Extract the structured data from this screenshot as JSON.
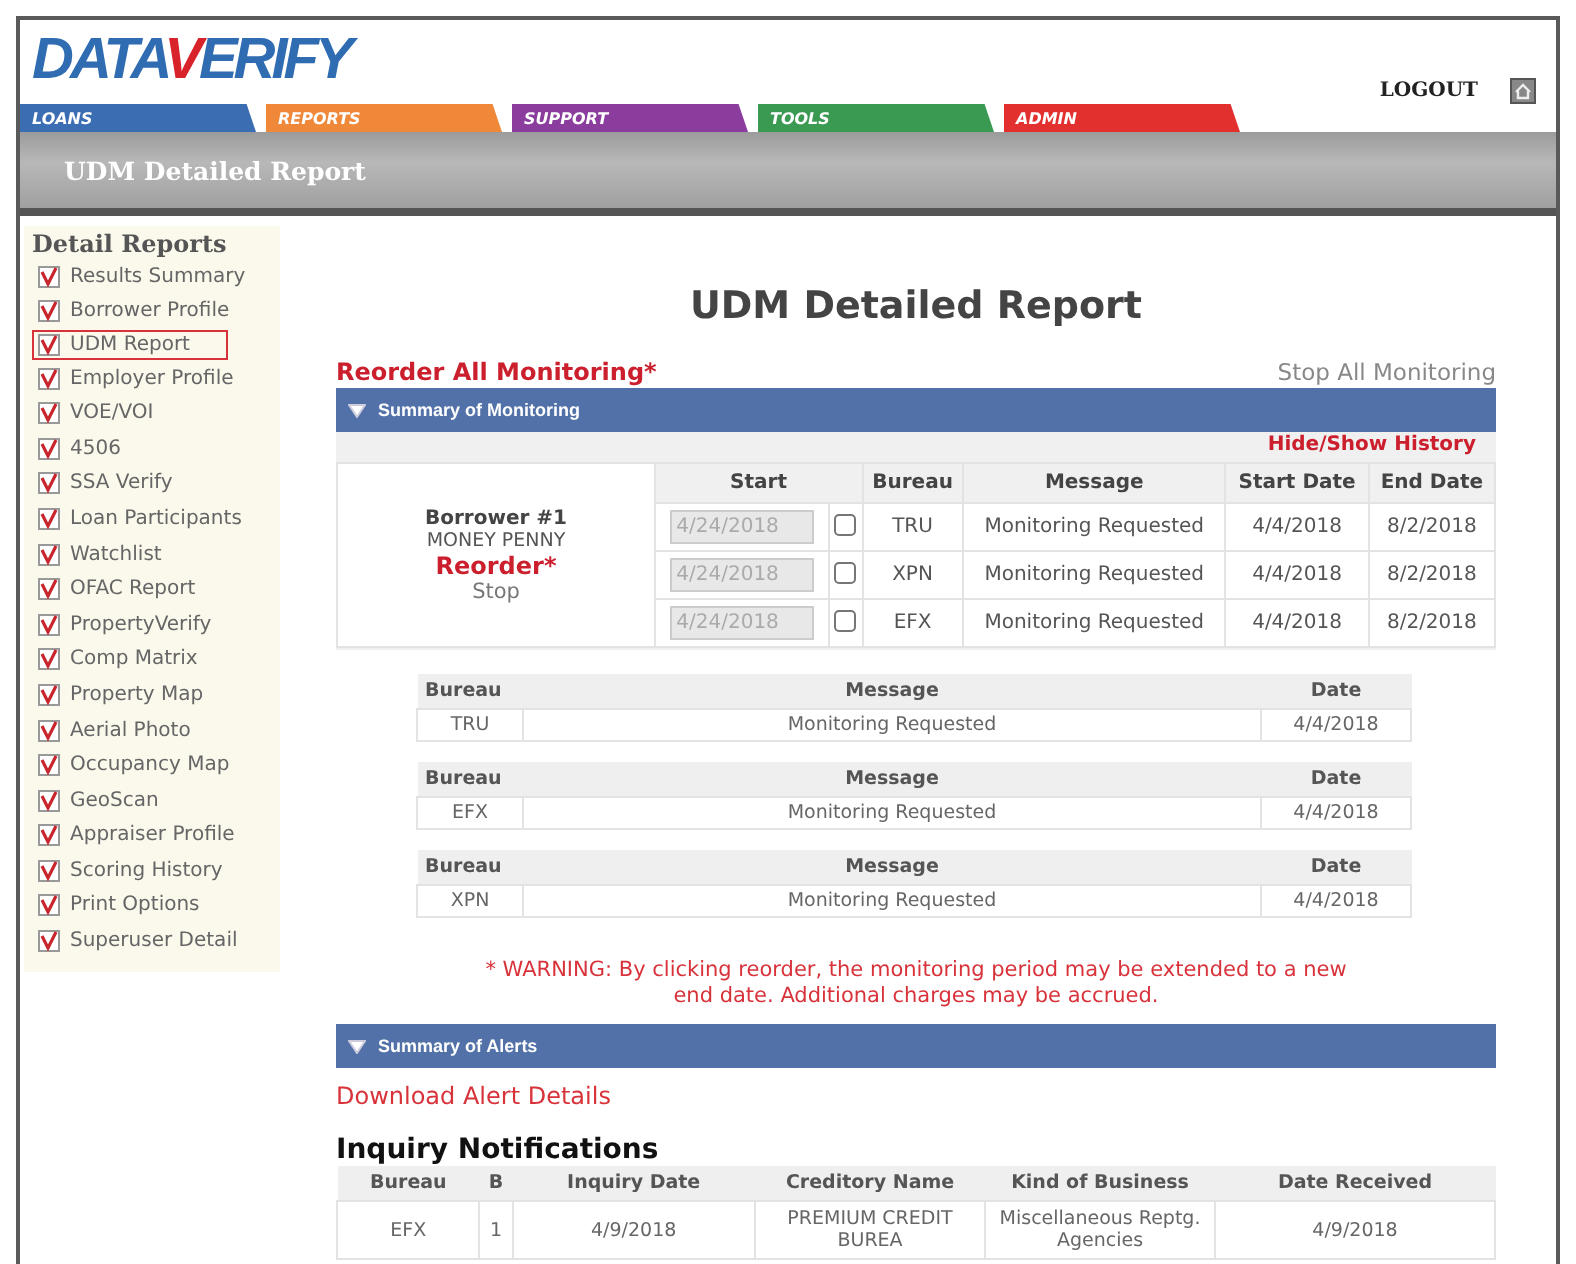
{
  "logo": {
    "part_1": "DATA",
    "part_2": "VERIFY"
  },
  "logout": "LOGOUT",
  "nav_tabs": [
    {
      "label": "LOANS",
      "color": "#3b6db3"
    },
    {
      "label": "REPORTS",
      "color": "#f0883a"
    },
    {
      "label": "SUPPORT",
      "color": "#8b3d9e"
    },
    {
      "label": "TOOLS",
      "color": "#3a9a52"
    },
    {
      "label": "ADMIN",
      "color": "#e2302f"
    }
  ],
  "title_bar": "UDM Detailed Report",
  "sidebar": {
    "heading": "Detail Reports",
    "items": [
      {
        "label": "Results Summary",
        "selected": false
      },
      {
        "label": "Borrower Profile",
        "selected": false
      },
      {
        "label": "UDM Report",
        "selected": true
      },
      {
        "label": "Employer Profile",
        "selected": false
      },
      {
        "label": "VOE/VOI",
        "selected": false
      },
      {
        "label": "4506",
        "selected": false
      },
      {
        "label": "SSA Verify",
        "selected": false
      },
      {
        "label": "Loan Participants",
        "selected": false
      },
      {
        "label": "Watchlist",
        "selected": false
      },
      {
        "label": "OFAC Report",
        "selected": false
      },
      {
        "label": "PropertyVerify",
        "selected": false
      },
      {
        "label": "Comp Matrix",
        "selected": false
      },
      {
        "label": "Property Map",
        "selected": false
      },
      {
        "label": "Aerial Photo",
        "selected": false
      },
      {
        "label": "Occupancy Map",
        "selected": false
      },
      {
        "label": "GeoScan",
        "selected": false
      },
      {
        "label": "Appraiser Profile",
        "selected": false
      },
      {
        "label": "Scoring History",
        "selected": false
      },
      {
        "label": "Print Options",
        "selected": false
      },
      {
        "label": "Superuser Detail",
        "selected": false
      }
    ]
  },
  "main": {
    "title": "UDM Detailed Report",
    "reorder_all": "Reorder All Monitoring*",
    "stop_all": "Stop All Monitoring",
    "monitoring": {
      "section_title": "Summary of Monitoring",
      "hide_show": "Hide/Show History",
      "borrower": {
        "label": "Borrower #1",
        "name": "MONEY PENNY",
        "reorder": "Reorder*",
        "stop": "Stop"
      },
      "columns": [
        "Start",
        "Bureau",
        "Message",
        "Start Date",
        "End Date"
      ],
      "rows": [
        {
          "start": "4/24/2018",
          "checked": false,
          "bureau": "TRU",
          "message": "Monitoring Requested",
          "start_date": "4/4/2018",
          "end_date": "8/2/2018"
        },
        {
          "start": "4/24/2018",
          "checked": false,
          "bureau": "XPN",
          "message": "Monitoring Requested",
          "start_date": "4/4/2018",
          "end_date": "8/2/2018"
        },
        {
          "start": "4/24/2018",
          "checked": false,
          "bureau": "EFX",
          "message": "Monitoring Requested",
          "start_date": "4/4/2018",
          "end_date": "8/2/2018"
        }
      ]
    },
    "history": [
      {
        "columns": [
          "Bureau",
          "Message",
          "Date"
        ],
        "row": [
          "TRU",
          "Monitoring Requested",
          "4/4/2018"
        ]
      },
      {
        "columns": [
          "Bureau",
          "Message",
          "Date"
        ],
        "row": [
          "EFX",
          "Monitoring Requested",
          "4/4/2018"
        ]
      },
      {
        "columns": [
          "Bureau",
          "Message",
          "Date"
        ],
        "row": [
          "XPN",
          "Monitoring Requested",
          "4/4/2018"
        ]
      }
    ],
    "warning": "* WARNING: By clicking reorder, the monitoring period may be extended to a new end date. Additional charges may be accrued.",
    "alerts": {
      "section_title": "Summary of Alerts",
      "download": "Download Alert Details",
      "inquiry_title": "Inquiry Notifications",
      "columns": [
        "Bureau",
        "B",
        "Inquiry Date",
        "Creditory Name",
        "Kind of Business",
        "Date Received"
      ],
      "rows": [
        [
          "EFX",
          "1",
          "4/9/2018",
          "PREMIUM CREDIT BUREA",
          "Miscellaneous Reptg. Agencies",
          "4/9/2018"
        ]
      ]
    }
  }
}
